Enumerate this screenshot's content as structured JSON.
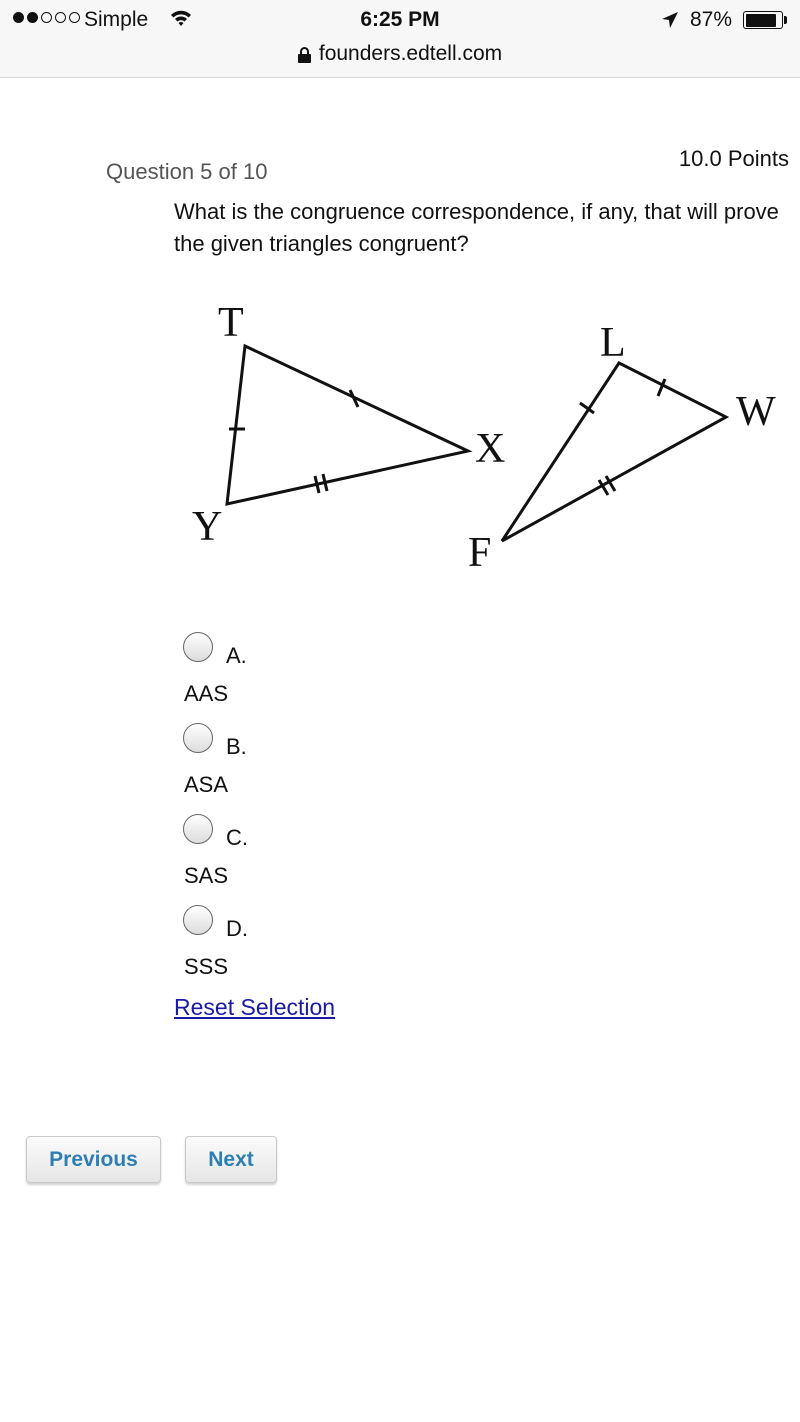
{
  "status_bar": {
    "signal_bars_filled": 2,
    "signal_bars_total": 5,
    "carrier": "Simple",
    "wifi_icon": "wifi-icon",
    "time": "6:25 PM",
    "location_icon": "location-arrow-icon",
    "battery_percent": "87%",
    "battery_level": 0.87
  },
  "browser": {
    "lock_icon": "lock-icon",
    "url": "founders.edtell.com"
  },
  "question": {
    "number_label": "Question 5 of 10",
    "points_label": "10.0 Points",
    "prompt": "What is the congruence correspondence, if any, that will prove the given triangles congruent?"
  },
  "figure": {
    "triangle1": {
      "vertices": [
        "T",
        "X",
        "Y"
      ],
      "tick_marks": {
        "TY": 1,
        "TX": 1,
        "YX": 2
      }
    },
    "triangle2": {
      "vertices": [
        "L",
        "W",
        "F"
      ],
      "tick_marks": {
        "LF": 1,
        "LW": 1,
        "FW": 2
      }
    }
  },
  "options": [
    {
      "letter": "A.",
      "text": "AAS",
      "selected": false
    },
    {
      "letter": "B.",
      "text": "ASA",
      "selected": false
    },
    {
      "letter": "C.",
      "text": "SAS",
      "selected": false
    },
    {
      "letter": "D.",
      "text": "SSS",
      "selected": false
    }
  ],
  "reset_label": "Reset Selection",
  "navigation": {
    "previous_label": "Previous",
    "next_label": "Next"
  }
}
